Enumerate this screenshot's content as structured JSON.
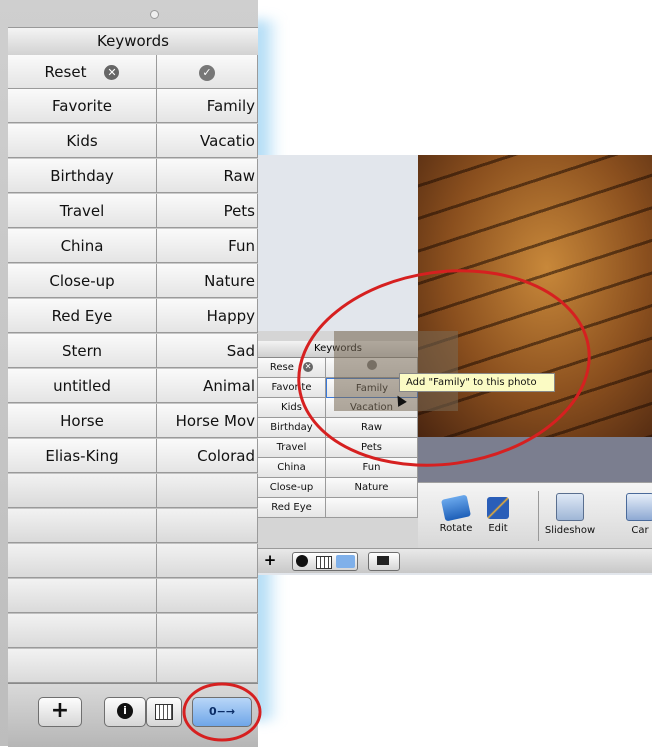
{
  "left_panel": {
    "title": "Keywords",
    "reset_label": "Reset",
    "rows": [
      [
        "Favorite",
        "Family"
      ],
      [
        "Kids",
        "Vacatio"
      ],
      [
        "Birthday",
        "Raw"
      ],
      [
        "Travel",
        "Pets"
      ],
      [
        "China",
        "Fun"
      ],
      [
        "Close-up",
        "Nature"
      ],
      [
        "Red Eye",
        "Happy"
      ],
      [
        "Stern",
        "Sad"
      ],
      [
        "untitled",
        "Animal"
      ],
      [
        "Horse",
        "Horse Mov"
      ],
      [
        "Elias-King",
        "Colorad"
      ]
    ],
    "toolbar": {
      "add_label": "+",
      "info_label": "i",
      "key_label": "0−→"
    }
  },
  "small_panel": {
    "title": "Keywords",
    "reset_label": "Rese",
    "rows": [
      [
        "Favorite",
        "Family"
      ],
      [
        "Kids",
        "Vacation"
      ],
      [
        "Birthday",
        "Raw"
      ],
      [
        "Travel",
        "Pets"
      ],
      [
        "China",
        "Fun"
      ],
      [
        "Close-up",
        "Nature"
      ],
      [
        "Red Eye",
        ""
      ]
    ]
  },
  "tooltip": "Add \"Family\" to this photo",
  "toolbar": {
    "rotate_label": "Rotate",
    "edit_label": "Edit",
    "slideshow_label": "Slideshow",
    "card_label": "Car"
  },
  "colors": {
    "highlight_circle": "#d62020",
    "glow": "#5ab4eb",
    "tooltip_bg": "#fbfbc4"
  }
}
